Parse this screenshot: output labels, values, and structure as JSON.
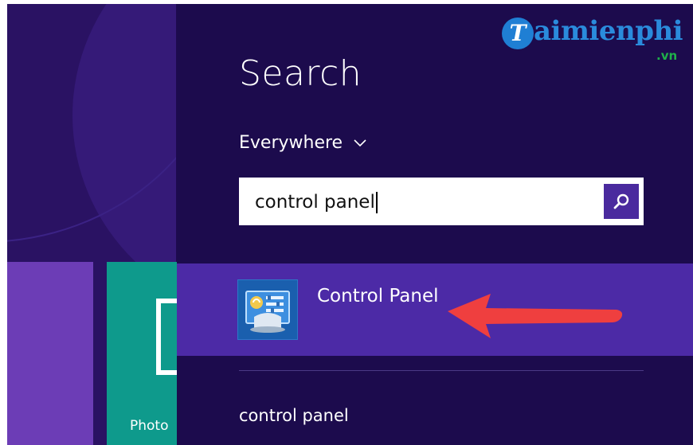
{
  "start_screen": {
    "photos_tile_label": "Photo"
  },
  "search_pane": {
    "title": "Search",
    "scope_label": "Everywhere",
    "query_value": "control panel",
    "search_button_icon": "magnifier-icon",
    "result": {
      "name": "Control Panel",
      "icon": "control-panel-icon"
    },
    "suggestion": "control panel"
  },
  "watermark": {
    "logo_letter": "T",
    "logo_text": "aimienphi",
    "logo_suffix": ".vn"
  },
  "colors": {
    "pane_background": "#1c0b4d",
    "result_highlight": "#4c2aa6",
    "search_button": "#4a2a9e",
    "arrow": "#ef3f3f",
    "photos_tile": "#0e9a8c"
  }
}
